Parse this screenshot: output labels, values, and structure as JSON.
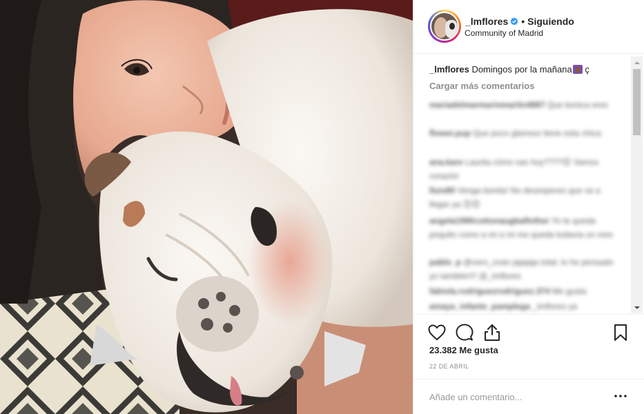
{
  "post": {
    "username": "_lmflores",
    "separator": "•",
    "follow_state": "Siguiendo",
    "location": "Community of Madrid",
    "caption_user": "_lmflores",
    "caption_text": "Domingos por la mañana",
    "caption_extra": "ç",
    "load_more": "Cargar más comentarios",
    "likes": "23.382 Me gusta",
    "date": "22 DE ABRIL",
    "add_comment_placeholder": "Añade un comentario...",
    "more_options": "•••"
  },
  "comments": [
    {
      "user": "mariadelmarmarinmartin4887",
      "text": "Que bonica eres"
    },
    {
      "user": "flower.pup",
      "text": "Que poco glamour tiene esta chica"
    },
    {
      "user": "ana.kare",
      "text": "Laurita cómo vas hoy????😊 Vamos corazón"
    },
    {
      "user": "lluis80",
      "text": "Venga bonita! No desesperes que va a llegar ya 😊😊"
    },
    {
      "user": "angela1990cottonaugbalfother",
      "text": "Yo te queda poquito como a mi a mi me queda todavía un mes"
    },
    {
      "user": "pablo_p",
      "text": "@vero_ovan jajajaja total, lo he pensado yo también!!! @_lmflores"
    },
    {
      "user": "fabiola.rodriguezrodriguez.374",
      "text": "Me gusta"
    },
    {
      "user": "amaya_infante_pamplega",
      "text": "_lmflores ya"
    }
  ],
  "colors": {
    "verified": "#3897f0",
    "muted": "#8e8e8e",
    "link": "#003569"
  },
  "icons": [
    "verified-badge-icon",
    "heart-icon",
    "comment-icon",
    "share-icon",
    "bookmark-icon",
    "more-icon",
    "scroll-up-icon",
    "scroll-down-icon"
  ]
}
